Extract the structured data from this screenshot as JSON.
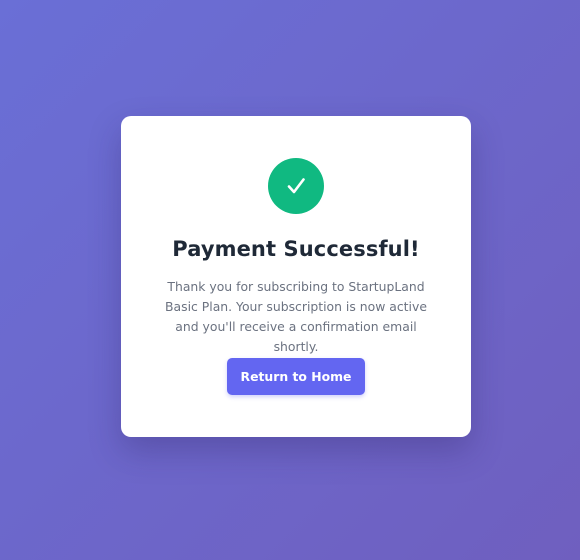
{
  "dialog": {
    "title": "Payment Successful!",
    "message": "Thank you for subscribing to StartupLand Basic Plan. Your subscription is now active and you'll receive a confirmation email shortly.",
    "button_label": "Return to Home",
    "status_icon": "check-icon"
  },
  "colors": {
    "background_start": "#6a6fd6",
    "background_end": "#6f5fbf",
    "success": "#10b981",
    "accent": "#6366f1",
    "title": "#1f2937",
    "text": "#6b7280"
  }
}
